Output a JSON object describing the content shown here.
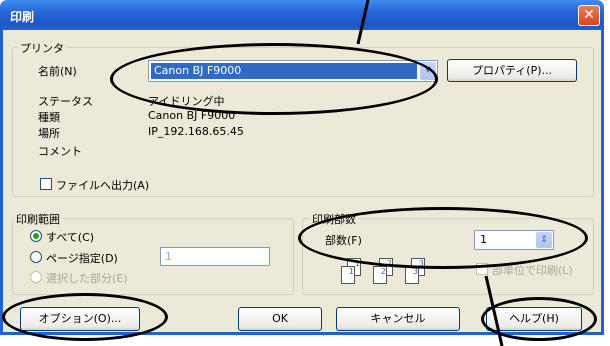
{
  "dialog": {
    "title": "印刷",
    "close_glyph": "✕"
  },
  "printer": {
    "group_label": "プリンタ",
    "name_label": "名前(N)",
    "name_value": "Canon BJ F9000",
    "properties_button": "プロパティ(P)...",
    "status_label": "ステータス",
    "status_value": "アイドリング中",
    "type_label": "種類",
    "type_value": "Canon BJ F9000",
    "location_label": "場所",
    "location_value": "IP_192.168.65.45",
    "comment_label": "コメント",
    "print_to_file_label": "ファイルへ出力(A)"
  },
  "range": {
    "group_label": "印刷範囲",
    "all_label": "すべて(C)",
    "pages_label": "ページ指定(D)",
    "pages_value": "1",
    "selection_label": "選択した部分(E)"
  },
  "copies": {
    "group_label": "印刷部数",
    "count_label": "部数(F)",
    "count_value": "1",
    "collate_label": "部単位で印刷(L)",
    "page_numbers": [
      "1",
      "2",
      "3",
      "1",
      "2",
      "3"
    ]
  },
  "buttons": {
    "options": "オプション(O)...",
    "ok": "OK",
    "cancel": "キャンセル",
    "help": "ヘルプ(H)"
  },
  "icons": {
    "dropdown": "chevron-down-icon",
    "spin": "spin-icon"
  }
}
